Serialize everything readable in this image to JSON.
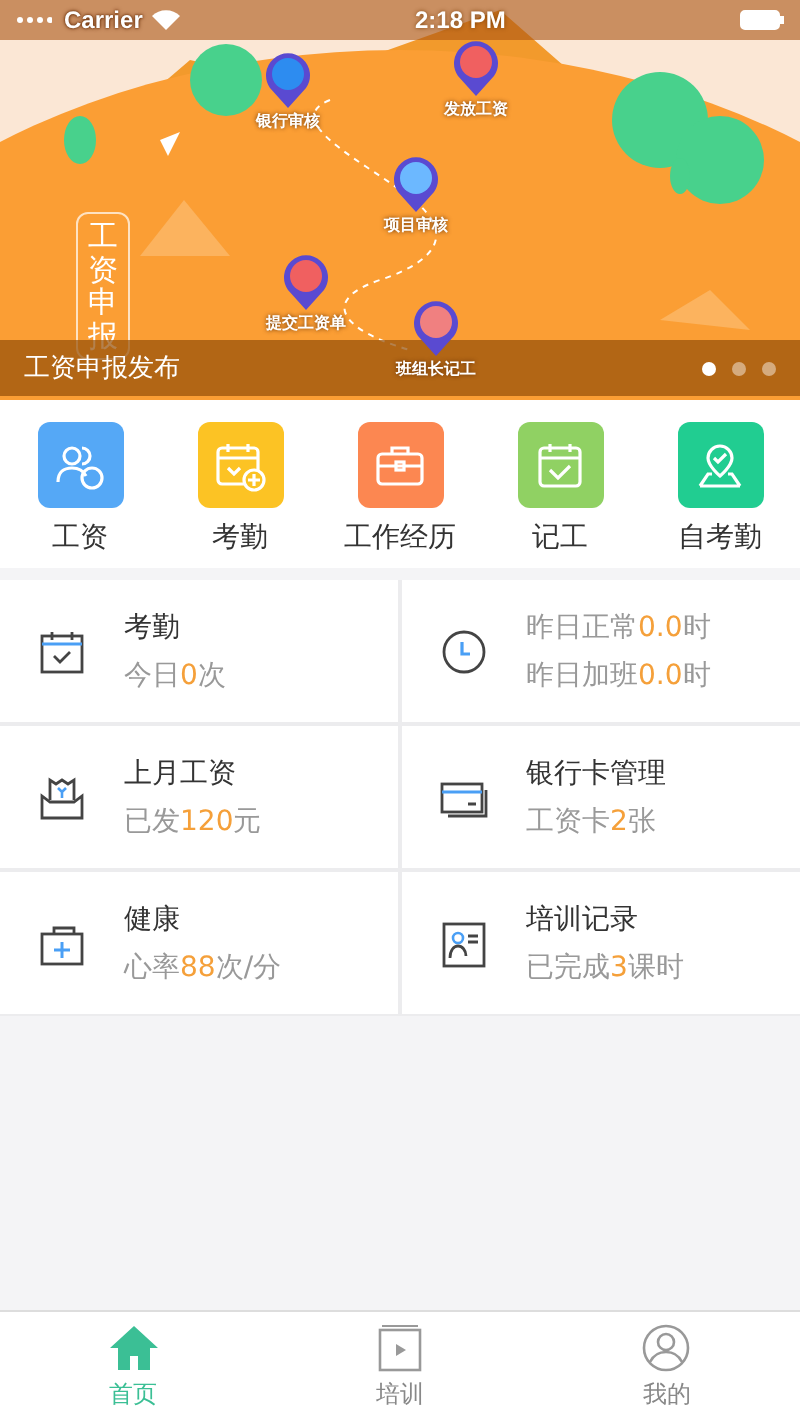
{
  "status_bar": {
    "carrier": "Carrier",
    "time": "2:18 PM"
  },
  "banner": {
    "sign": "工资申报",
    "caption": "工资申报发布",
    "milestones": [
      {
        "label": "银行审核"
      },
      {
        "label": "发放工资"
      },
      {
        "label": "项目审核"
      },
      {
        "label": "提交工资单"
      },
      {
        "label": "班组长记工"
      }
    ],
    "dots": [
      {
        "selected": true
      },
      {
        "selected": false
      },
      {
        "selected": false
      }
    ]
  },
  "shortcuts": [
    {
      "kind": "salary",
      "label": "工资",
      "color": "#55a8f6"
    },
    {
      "kind": "attendance",
      "label": "考勤",
      "color": "#fcc324"
    },
    {
      "kind": "work",
      "label": "工作经历",
      "color": "#fc8751"
    },
    {
      "kind": "record",
      "label": "记工",
      "color": "#90d163"
    },
    {
      "kind": "self",
      "label": "自考勤",
      "color": "#21cd91"
    }
  ],
  "cards": [
    {
      "kind": "calendar",
      "title": "考勤",
      "lines": [
        {
          "pre": "今日",
          "num": "0",
          "post": "次"
        }
      ]
    },
    {
      "kind": "clock",
      "lines": [
        {
          "pre": "昨日正常",
          "num": "0.0",
          "post": "时"
        },
        {
          "pre": "昨日加班",
          "num": "0.0",
          "post": "时"
        }
      ]
    },
    {
      "kind": "wallet",
      "title": "上月工资",
      "lines": [
        {
          "pre": "已发",
          "num": "120",
          "post": "元"
        }
      ]
    },
    {
      "kind": "card",
      "title": "银行卡管理",
      "lines": [
        {
          "pre": "工资卡",
          "num": "2",
          "post": "张"
        }
      ]
    },
    {
      "kind": "health",
      "title": "健康",
      "lines": [
        {
          "pre": "心率",
          "num": "88",
          "post": "次/分"
        }
      ]
    },
    {
      "kind": "training",
      "title": "培训记录",
      "lines": [
        {
          "pre": "已完成",
          "num": "3",
          "post": "课时"
        }
      ]
    }
  ],
  "tabs": [
    {
      "kind": "home",
      "label": "首页",
      "selected": true
    },
    {
      "kind": "video",
      "label": "培训",
      "selected": false
    },
    {
      "kind": "user",
      "label": "我的",
      "selected": false
    }
  ]
}
